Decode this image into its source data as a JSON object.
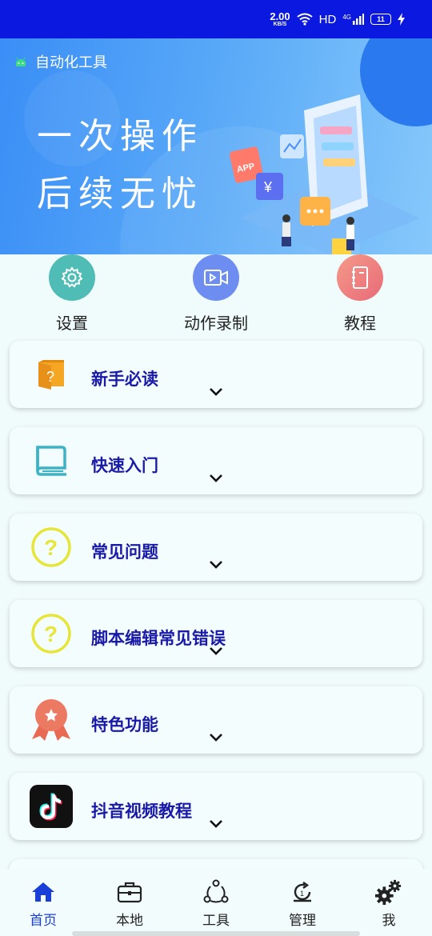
{
  "status_bar": {
    "net_speed": "2.00",
    "net_unit": "KB/S",
    "network_label": "HD",
    "signal_label": "4G",
    "battery": "11"
  },
  "banner": {
    "app_title": "自动化工具",
    "slogan_line1": "一次操作",
    "slogan_line2": "后续无忧",
    "illus_app_text": "APP",
    "illus_currency": "¥"
  },
  "quick_actions": [
    {
      "label": "设置",
      "icon": "gear-icon",
      "color": "#4fbcb6"
    },
    {
      "label": "动作录制",
      "icon": "video-record-icon",
      "color": "#6d8ef0"
    },
    {
      "label": "教程",
      "icon": "notebook-icon",
      "color": "#ee7f7f"
    }
  ],
  "cards": [
    {
      "title": "新手必读",
      "icon": "book-question-icon"
    },
    {
      "title": "快速入门",
      "icon": "open-book-icon"
    },
    {
      "title": "常见问题",
      "icon": "question-circle-icon"
    },
    {
      "title": "脚本编辑常见错误",
      "icon": "question-circle-icon"
    },
    {
      "title": "特色功能",
      "icon": "badge-star-icon"
    },
    {
      "title": "抖音视频教程",
      "icon": "tiktok-icon"
    }
  ],
  "bottom_nav": [
    {
      "label": "首页",
      "icon": "home-icon",
      "active": true
    },
    {
      "label": "本地",
      "icon": "briefcase-icon",
      "active": false
    },
    {
      "label": "工具",
      "icon": "share-nodes-icon",
      "active": false
    },
    {
      "label": "管理",
      "icon": "refresh-icon",
      "active": false
    },
    {
      "label": "我",
      "icon": "gears-icon",
      "active": false
    }
  ],
  "colors": {
    "status_bar": "#0a18e0",
    "card_title": "#1a1aa8",
    "active_nav": "#1a3fd8",
    "background": "#f0fbfb"
  }
}
